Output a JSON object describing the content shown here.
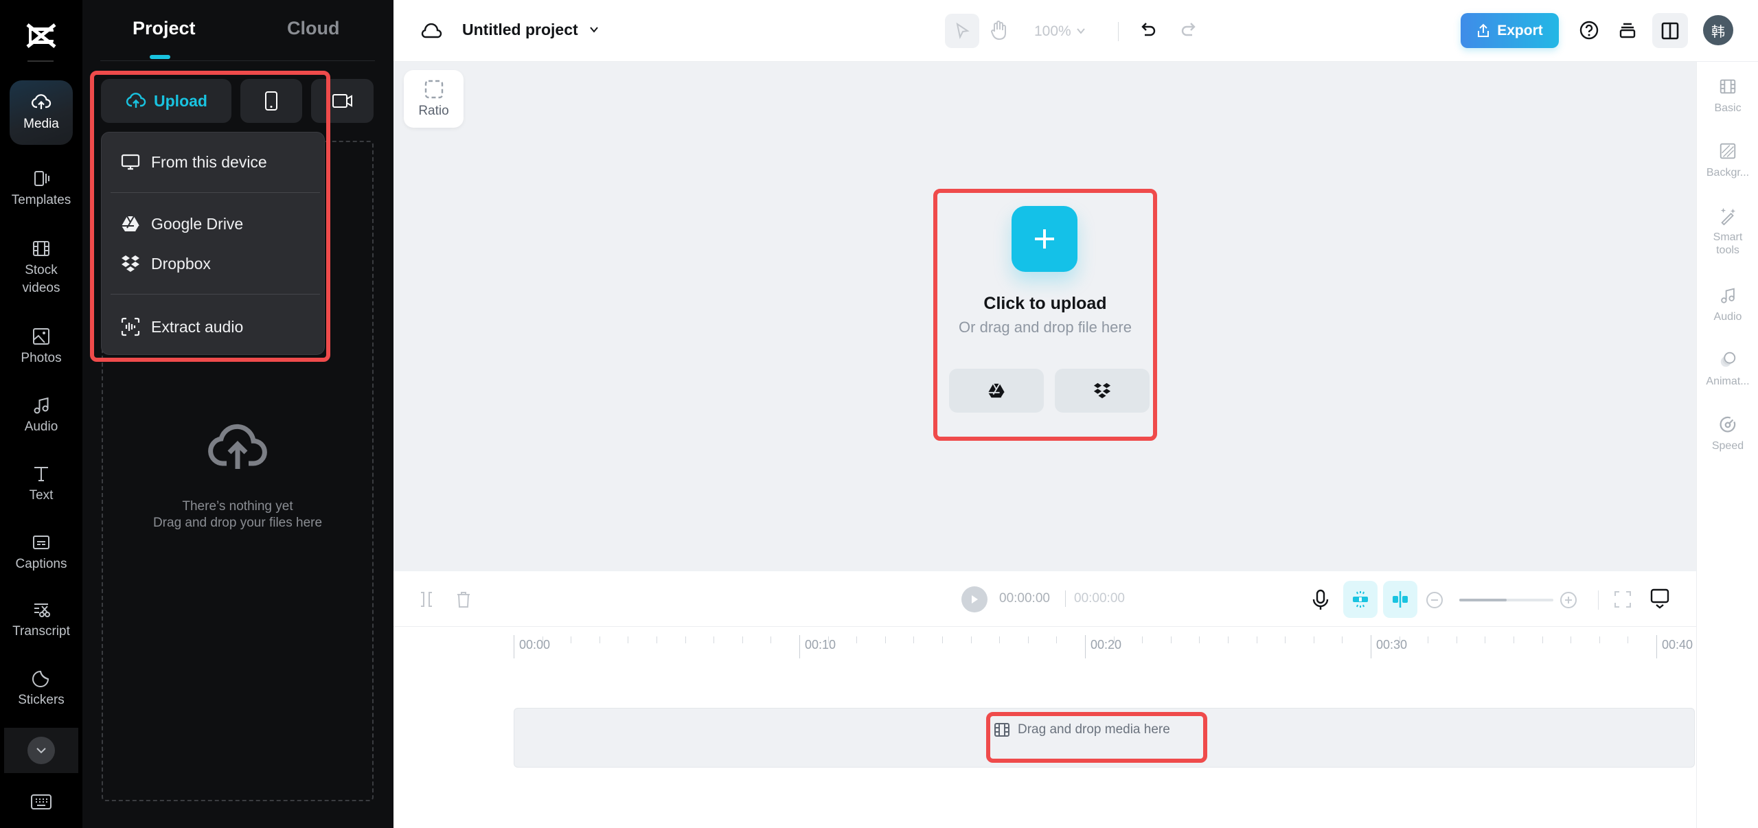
{
  "app": {
    "brand_icon": "capcut-logo-icon"
  },
  "left_nav": {
    "items": [
      {
        "label": "Media",
        "icon": "cloud-upload-icon",
        "active": true
      },
      {
        "label": "Templates",
        "icon": "templates-icon"
      },
      {
        "label": "Stock videos",
        "icon": "film-icon"
      },
      {
        "label": "Photos",
        "icon": "image-icon"
      },
      {
        "label": "Audio",
        "icon": "music-note-icon"
      },
      {
        "label": "Text",
        "icon": "text-icon"
      },
      {
        "label": "Captions",
        "icon": "captions-icon"
      },
      {
        "label": "Transcript",
        "icon": "transcript-icon"
      },
      {
        "label": "Stickers",
        "icon": "sticker-icon"
      }
    ],
    "more_icon": "chevron-down-icon",
    "keyboard_icon": "keyboard-icon"
  },
  "media_panel": {
    "tabs": [
      {
        "label": "Project",
        "active": true
      },
      {
        "label": "Cloud",
        "active": false
      }
    ],
    "upload_button": "Upload",
    "phone_button_icon": "phone-icon",
    "record_button_icon": "video-camera-icon",
    "empty_state": {
      "line1": "There’s nothing yet",
      "line2": "Drag and drop your files here"
    },
    "upload_menu": [
      {
        "label": "From this device",
        "icon": "monitor-icon"
      },
      {
        "label": "Google Drive",
        "icon": "google-drive-icon"
      },
      {
        "label": "Dropbox",
        "icon": "dropbox-icon"
      },
      {
        "label": "Extract audio",
        "icon": "extract-audio-icon"
      }
    ]
  },
  "header": {
    "project_title": "Untitled project",
    "zoom_level": "100%",
    "export_label": "Export",
    "avatar_text": "韩"
  },
  "canvas": {
    "ratio_label": "Ratio",
    "upload_card": {
      "title": "Click to upload",
      "subtitle": "Or drag and drop file here"
    }
  },
  "right_panel": {
    "items": [
      {
        "label": "Basic",
        "icon": "film-icon"
      },
      {
        "label": "Backgr...",
        "icon": "background-icon"
      },
      {
        "label": "Smart tools",
        "icon": "magic-wand-icon"
      },
      {
        "label": "Audio",
        "icon": "music-note-icon"
      },
      {
        "label": "Animat...",
        "icon": "animation-icon"
      },
      {
        "label": "Speed",
        "icon": "speed-icon"
      }
    ]
  },
  "timeline": {
    "current_time": "00:00:00",
    "total_time": "00:00:00",
    "zoom_fraction": 0.5,
    "ruler_labels": [
      "00:00",
      "00:10",
      "00:20",
      "00:30",
      "00:40"
    ],
    "drop_label": "Drag and drop media here"
  },
  "colors": {
    "accent": "#19c3e0",
    "export_gradient_start": "#3f8ce8",
    "export_gradient_end": "#23b7e5",
    "highlight": "#ef4b4b"
  }
}
